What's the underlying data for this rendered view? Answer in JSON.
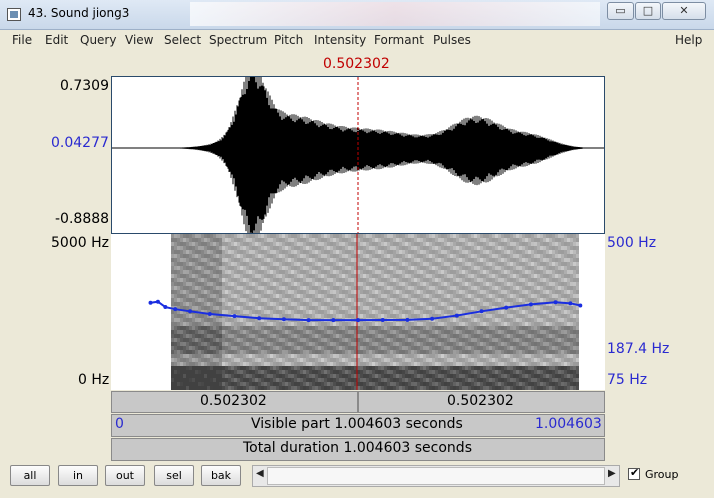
{
  "window": {
    "title": "43. Sound jiong3",
    "minimize": "▭",
    "maximize": "□",
    "close": "✕"
  },
  "menu": [
    "File",
    "Edit",
    "Query",
    "View",
    "Select",
    "Spectrum",
    "Pitch",
    "Intensity",
    "Formant",
    "Pulses",
    "Help"
  ],
  "cursor": {
    "time_label": "0.502302",
    "time": 0.502302
  },
  "waveform": {
    "ymax_label": "0.7309",
    "ymid_label": "0.04277",
    "ymin_label": "-0.8888"
  },
  "spectrogram": {
    "fmax_label": "5000 Hz",
    "fmin_label": "0 Hz"
  },
  "pitch_axis": {
    "max_label": "500 Hz",
    "value_label": "187.4 Hz",
    "min_label": "75 Hz"
  },
  "time_bars": {
    "left_label": "0.502302",
    "right_label": "0.502302",
    "visible_start": "0",
    "visible_text": "Visible part 1.004603 seconds",
    "visible_end": "1.004603",
    "total_text": "Total duration 1.004603 seconds"
  },
  "toolbar": {
    "all": "all",
    "in": "in",
    "out": "out",
    "sel": "sel",
    "bak": "bak",
    "group_label": "Group",
    "group_checked": true
  },
  "colors": {
    "cursor": "#c00000",
    "pitch": "#1a2ee0",
    "axis_blue": "#2a2ad0"
  },
  "pitch_track": {
    "x": [
      0.08,
      0.095,
      0.11,
      0.13,
      0.16,
      0.2,
      0.25,
      0.3,
      0.35,
      0.4,
      0.45,
      0.5,
      0.55,
      0.6,
      0.65,
      0.7,
      0.75,
      0.8,
      0.85,
      0.9,
      0.93,
      0.95
    ],
    "hz": [
      220,
      222,
      212,
      208,
      204,
      199,
      195,
      191,
      189,
      187.5,
      187.4,
      187.4,
      187.6,
      188,
      190,
      196,
      204,
      211,
      217,
      221,
      219,
      215
    ]
  }
}
